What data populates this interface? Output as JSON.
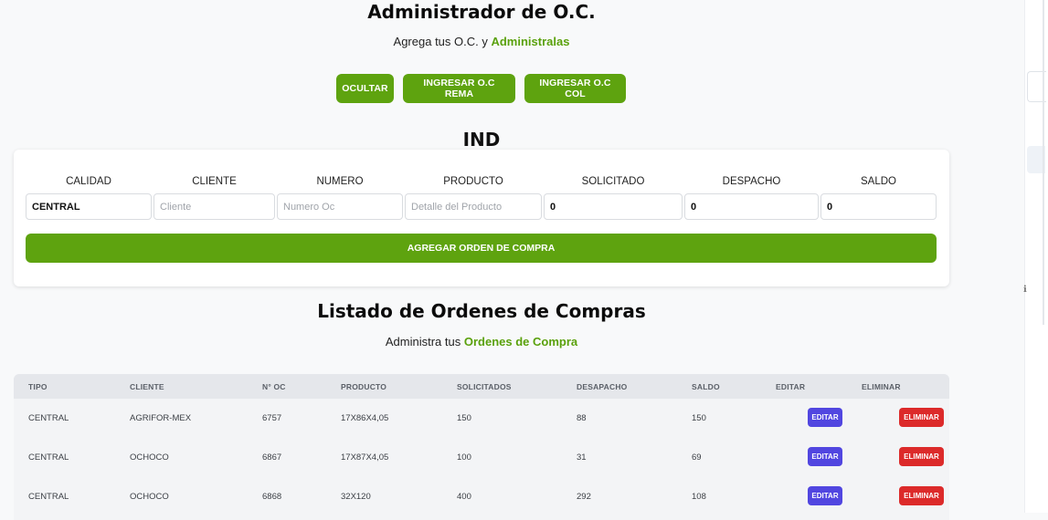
{
  "header": {
    "title": "Administrador de O.C.",
    "subtitle_prefix": "Agrega tus O.C. y ",
    "subtitle_accent": "Administralas"
  },
  "actions": {
    "hide_label": "OCULTAR",
    "rema_label": "INGRESAR O.C REMA",
    "col_label": "INGRESAR O.C COL"
  },
  "form": {
    "section_title": "IND",
    "columns": [
      "CALIDAD",
      "CLIENTE",
      "NUMERO",
      "PRODUCTO",
      "SOLICITADO",
      "DESPACHO",
      "SALDO"
    ],
    "calidad_value": "CENTRAL",
    "cliente_placeholder": "Cliente",
    "numero_placeholder": "Numero Oc",
    "producto_placeholder": "Detalle del Producto",
    "solicitado_value": "0",
    "despacho_value": "0",
    "saldo_value": "0",
    "submit_label": "AGREGAR ORDEN DE COMPRA"
  },
  "list": {
    "title": "Listado de Ordenes de Compras",
    "subtitle_prefix": "Administra tus ",
    "subtitle_accent": "Ordenes de Compra",
    "headers": [
      "TIPO",
      "CLIENTE",
      "N° OC",
      "PRODUCTO",
      "SOLICITADOS",
      "DESAPACHO",
      "SALDO",
      "EDITAR",
      "ELIMINAR"
    ],
    "rows": [
      {
        "tipo": "CENTRAL",
        "cliente": "AGRIFOR-MEX",
        "oc": "6757",
        "producto": "17X86X4,05",
        "solicitados": "150",
        "despacho": "88",
        "saldo": "150"
      },
      {
        "tipo": "CENTRAL",
        "cliente": "OCHOCO",
        "oc": "6867",
        "producto": "17X87X4,05",
        "solicitados": "100",
        "despacho": "31",
        "saldo": "69"
      },
      {
        "tipo": "CENTRAL",
        "cliente": "OCHOCO",
        "oc": "6868",
        "producto": "32X120",
        "solicitados": "400",
        "despacho": "292",
        "saldo": "108"
      }
    ],
    "edit_label": "EDITAR",
    "delete_label": "ELIMINAR"
  },
  "colors": {
    "accent_green": "#5ea30f",
    "edit_blue": "#5146e0",
    "delete_red": "#dc2a2a"
  }
}
